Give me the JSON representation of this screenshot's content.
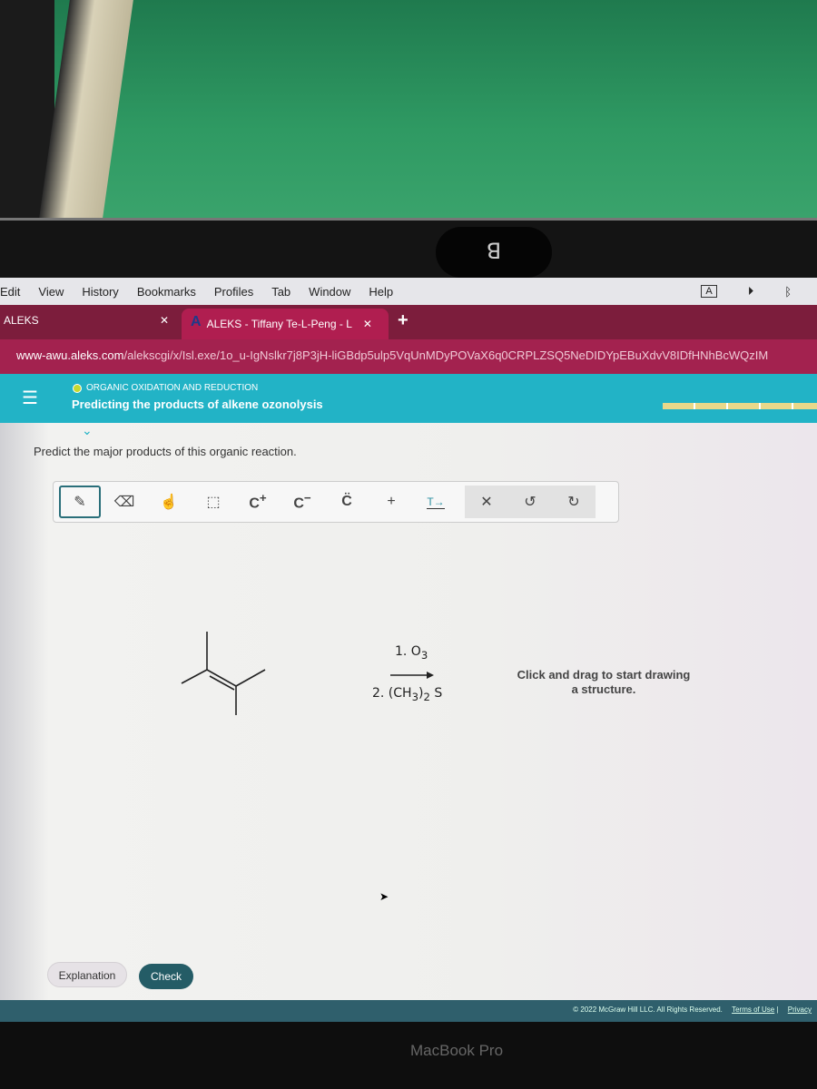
{
  "menubar": {
    "items": [
      "Edit",
      "View",
      "History",
      "Bookmarks",
      "Profiles",
      "Tab",
      "Window",
      "Help"
    ],
    "status_a": "A"
  },
  "tabs": [
    {
      "label": "ALEKS"
    },
    {
      "label": "ALEKS - Tiffany Te-L-Peng - L",
      "logo": "A"
    }
  ],
  "url": {
    "host": "www-awu.aleks.com",
    "path": "/alekscgi/x/Isl.exe/1o_u-IgNslkr7j8P3jH-liGBdp5ulp5VqUnMDyPOVaX6q0CRPLZSQ5NeDIDYpEBuXdvV8IDfHNhBcWQzIM"
  },
  "header": {
    "topic": "ORGANIC OXIDATION AND REDUCTION",
    "title": "Predicting the products of alkene ozonolysis"
  },
  "question": {
    "prompt": "Predict the major products of this organic reaction."
  },
  "toolbar": {
    "tools": [
      "pencil",
      "eraser",
      "hand",
      "select",
      "C+",
      "C-",
      "C:",
      "+",
      "text-arrow",
      "clear",
      "undo",
      "redo"
    ]
  },
  "reaction": {
    "step1": "1. O",
    "step1_sub": "3",
    "step2_pre": "2. (CH",
    "step2_sub1": "3",
    "step2_mid": ")",
    "step2_sub2": "2",
    "step2_post": "S"
  },
  "canvas": {
    "hint": "Click and drag to start drawing a structure."
  },
  "buttons": {
    "explanation": "Explanation",
    "check": "Check"
  },
  "footer": {
    "copyright": "© 2022 McGraw Hill LLC. All Rights Reserved.",
    "terms": "Terms of Use",
    "privacy": "Privacy"
  },
  "device": {
    "label": "MacBook Pro"
  },
  "colors": {
    "tabbar": "#7c1d3c",
    "urlbar": "#a3224f",
    "header": "#22b3c6",
    "check": "#245c66"
  }
}
